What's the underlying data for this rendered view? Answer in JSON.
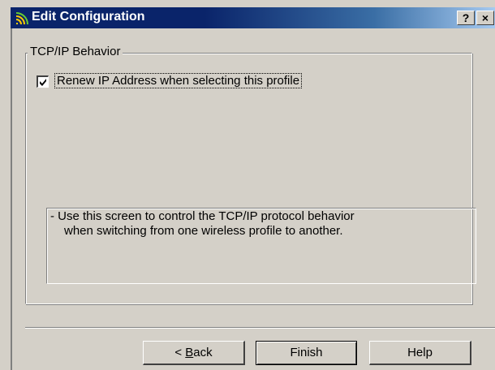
{
  "window": {
    "title": "Edit Configuration",
    "caption_help": "?",
    "caption_close": "×"
  },
  "group": {
    "legend": "TCP/IP Behavior"
  },
  "checkbox": {
    "label": "Renew IP Address when selecting this profile",
    "checked": true
  },
  "description": {
    "line1": "- Use this screen to control the TCP/IP protocol behavior",
    "line2": "when switching from one wireless profile to another."
  },
  "buttons": {
    "back_prefix": "< ",
    "back_mnemonic": "B",
    "back_rest": "ack",
    "finish": "Finish",
    "help": "Help"
  },
  "icons": {
    "title_icon": "wireless-signal-icon"
  },
  "colors": {
    "title_bar": "#0a246a",
    "face": "#d4d0c8"
  }
}
